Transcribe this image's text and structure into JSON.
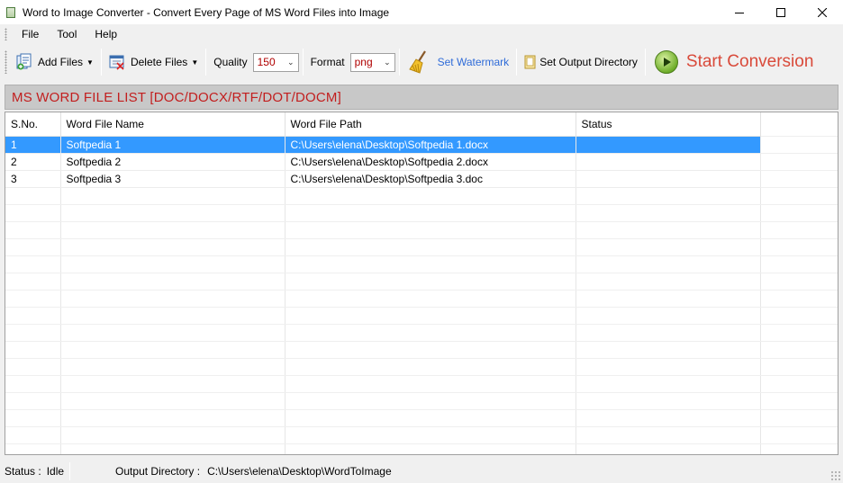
{
  "window": {
    "title": "Word to Image Converter - Convert Every Page of MS Word Files into Image"
  },
  "menu": [
    "File",
    "Tool",
    "Help"
  ],
  "toolbar": {
    "add_files": "Add Files",
    "delete_files": "Delete Files",
    "quality_label": "Quality",
    "quality_value": "150",
    "format_label": "Format",
    "format_value": "png",
    "set_watermark": "Set Watermark",
    "set_output_directory": "Set Output Directory",
    "start_conversion": "Start Conversion"
  },
  "panel": {
    "title": "MS WORD FILE LIST [DOC/DOCX/RTF/DOT/DOCM]"
  },
  "table": {
    "columns": [
      "S.No.",
      "Word File Name",
      "Word File Path",
      "Status"
    ],
    "rows": [
      [
        "1",
        "Softpedia 1",
        "C:\\Users\\elena\\Desktop\\Softpedia 1.docx",
        ""
      ],
      [
        "2",
        "Softpedia 2",
        "C:\\Users\\elena\\Desktop\\Softpedia 2.docx",
        ""
      ],
      [
        "3",
        "Softpedia 3",
        "C:\\Users\\elena\\Desktop\\Softpedia 3.doc",
        ""
      ]
    ],
    "selected_row": 0
  },
  "statusbar": {
    "status_label": "Status :",
    "status_value": "Idle",
    "output_label": "Output Directory :",
    "output_value": "C:\\Users\\elena\\Desktop\\WordToImage"
  },
  "colors": {
    "selection": "#3399ff",
    "panel_title": "#c21e1e",
    "start_text": "#d94a3a",
    "watermark_link": "#2e6bd8"
  }
}
